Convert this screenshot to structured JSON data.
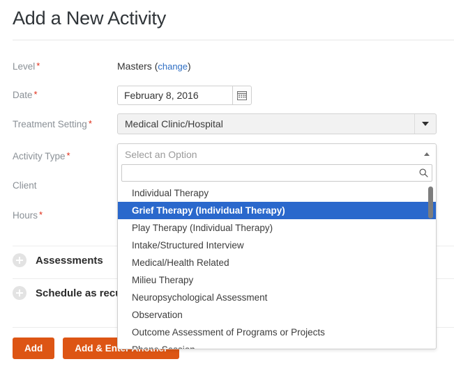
{
  "page": {
    "title": "Add a New Activity",
    "required_marker": "*"
  },
  "form": {
    "level": {
      "label": "Level",
      "value": "Masters",
      "change_link": "change",
      "paren_open": "(",
      "paren_close": ")"
    },
    "date": {
      "label": "Date",
      "value": "February 8, 2016",
      "calendar_icon": "calendar-icon"
    },
    "treatment_setting": {
      "label": "Treatment Setting",
      "value": "Medical Clinic/Hospital",
      "caret_icon": "chevron-down-icon"
    },
    "activity_type": {
      "label": "Activity Type",
      "placeholder": "Select an Option",
      "caret_icon": "chevron-up-icon",
      "search_value": "",
      "search_placeholder": "",
      "search_icon": "search-icon",
      "selected_option": "Grief Therapy (Individual Therapy)",
      "options": [
        "Individual Therapy",
        "Grief Therapy (Individual Therapy)",
        "Play Therapy (Individual Therapy)",
        "Intake/Structured Interview",
        "Medical/Health Related",
        "Milieu Therapy",
        "Neuropsychological Assessment",
        "Observation",
        "Outcome Assessment of Programs or Projects",
        "Phone Session"
      ]
    },
    "client": {
      "label": "Client",
      "value": "",
      "placeholder": ""
    },
    "hours": {
      "label": "Hours",
      "value": "",
      "placeholder": ""
    }
  },
  "sections": [
    {
      "title": "Assessments",
      "expand_icon": "plus-circle-icon"
    },
    {
      "title": "Schedule as recurring",
      "expand_icon": "plus-circle-icon"
    }
  ],
  "actions": {
    "add_label": "Add",
    "add_and_enter_another_label": "Add & Enter Another"
  },
  "colors": {
    "primary_button": "#dd5514",
    "highlight": "#2a68cc",
    "link": "#2f6fc4",
    "required": "#e02b16",
    "label_text": "#8a9096"
  }
}
